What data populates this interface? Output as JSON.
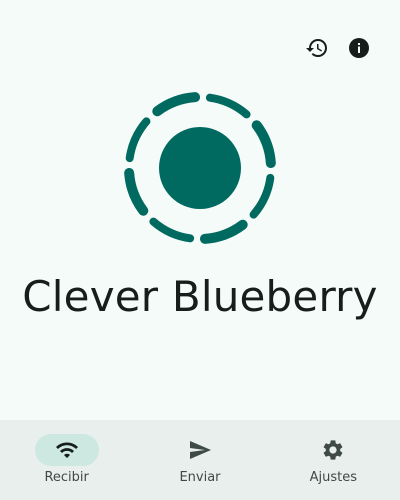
{
  "device": {
    "name": "Clever Blueberry"
  },
  "colors": {
    "accent": "#006a60",
    "background": "#f5fbf8",
    "nav_background": "#e8efec",
    "nav_active_pill": "#cce8e1",
    "icon": "#171d1b"
  },
  "top_actions": [
    {
      "icon": "history-icon"
    },
    {
      "icon": "info-icon"
    }
  ],
  "nav": {
    "items": [
      {
        "label": "Recibir",
        "icon": "wifi-icon",
        "active": true
      },
      {
        "label": "Enviar",
        "icon": "send-icon",
        "active": false
      },
      {
        "label": "Ajustes",
        "icon": "gear-icon",
        "active": false
      }
    ]
  }
}
